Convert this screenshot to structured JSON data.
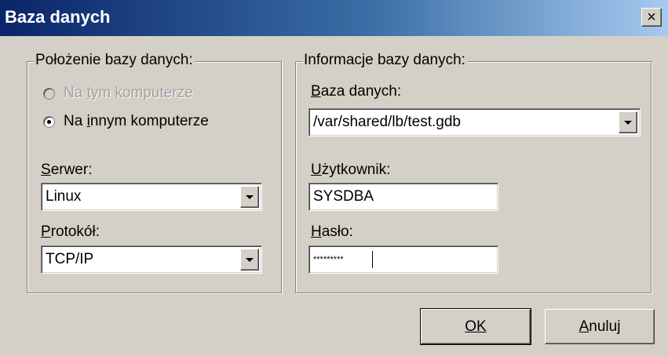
{
  "window": {
    "title": "Baza danych",
    "close_glyph": "×",
    "close_icon": "close-icon"
  },
  "location_group": {
    "legend": "Położenie bazy danych:",
    "radios": [
      {
        "label": "Na tym komputerze",
        "mnemonic": "t",
        "checked": false,
        "disabled": true
      },
      {
        "label": "Na innym komputerze",
        "mnemonic": "i",
        "checked": true,
        "disabled": false
      }
    ],
    "server": {
      "label": "Serwer:",
      "mnemonic": "S",
      "value": "Linux"
    },
    "protocol": {
      "label": "Protokół:",
      "mnemonic": "P",
      "value": "TCP/IP"
    }
  },
  "info_group": {
    "legend": "Informacje bazy danych:",
    "database": {
      "label": "Baza danych:",
      "mnemonic": "B",
      "value": "/var/shared/lb/test.gdb"
    },
    "user": {
      "label": "Użytkownik:",
      "mnemonic": "U",
      "value": "SYSDBA"
    },
    "password": {
      "label": "Hasło:",
      "mnemonic": "H",
      "value": "*********"
    }
  },
  "buttons": {
    "ok": {
      "label": "OK",
      "mnemonic": "O"
    },
    "cancel": {
      "label": "Anuluj",
      "mnemonic": "A"
    }
  },
  "colors": {
    "face": "#d4d0c8",
    "title_start": "#0a246a",
    "title_end": "#a6caf0",
    "disabled_text": "#a0a0a0"
  }
}
